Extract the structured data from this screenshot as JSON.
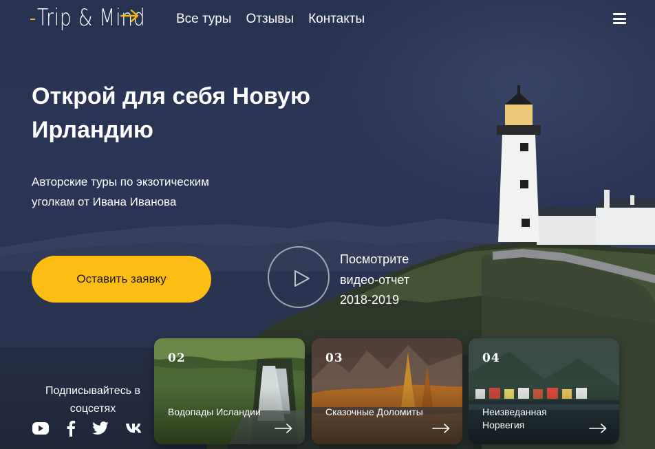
{
  "header": {
    "logo": "Trip & Mind",
    "nav": [
      "Все туры",
      "Отзывы",
      "Контакты"
    ],
    "accent_color": "#f5b800"
  },
  "hero": {
    "title": "Открой для себя Новую Ирландию",
    "subtitle": "Авторские туры по экзотическим уголкам от Ивана Иванова",
    "cta_label": "Оставить заявку",
    "cta_color": "#fcbe15",
    "video_lines": [
      "Посмотрите",
      "видео-отчет",
      "2018-2019"
    ]
  },
  "social": {
    "label": "Подписывайтесь в соцсетях",
    "icons": [
      "youtube-icon",
      "facebook-icon",
      "twitter-icon",
      "vk-icon"
    ]
  },
  "tours": [
    {
      "number": "02",
      "name": "Водопады Исландии"
    },
    {
      "number": "03",
      "name": "Сказочные Доломиты"
    },
    {
      "number": "04",
      "name": "Неизведанная Норвегия"
    }
  ]
}
